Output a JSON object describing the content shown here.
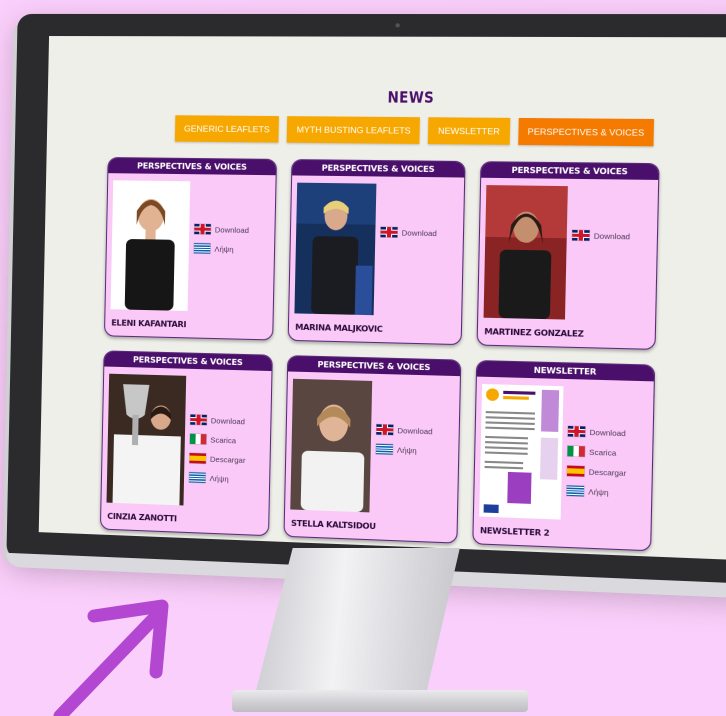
{
  "page": {
    "title": "NEWS"
  },
  "tabs": [
    {
      "label": "GENERIC LEAFLETS",
      "active": false
    },
    {
      "label": "MYTH BUSTING LEAFLETS",
      "active": false
    },
    {
      "label": "NEWSLETTER",
      "active": false
    },
    {
      "label": "PERSPECTIVES & VOICES",
      "active": true
    }
  ],
  "cards": [
    {
      "header": "PERSPECTIVES & VOICES",
      "name": "ELENI KAFANTARI",
      "links": [
        {
          "flag": "uk",
          "label": "Download"
        },
        {
          "flag": "gr",
          "label": "Λήψη"
        }
      ]
    },
    {
      "header": "PERSPECTIVES & VOICES",
      "name": "MARINA MALJKOVIC",
      "links": [
        {
          "flag": "uk",
          "label": "Download"
        }
      ]
    },
    {
      "header": "PERSPECTIVES & VOICES",
      "name": "MARTINEZ GONZALEZ",
      "links": [
        {
          "flag": "uk",
          "label": "Download"
        }
      ]
    },
    {
      "header": "PERSPECTIVES & VOICES",
      "name": "CINZIA ZANOTTI",
      "links": [
        {
          "flag": "uk",
          "label": "Download"
        },
        {
          "flag": "it",
          "label": "Scarica"
        },
        {
          "flag": "es",
          "label": "Descargar"
        },
        {
          "flag": "gr",
          "label": "Λήψη"
        }
      ]
    },
    {
      "header": "PERSPECTIVES & VOICES",
      "name": "STELLA KALTSIDOU",
      "links": [
        {
          "flag": "uk",
          "label": "Download"
        },
        {
          "flag": "gr",
          "label": "Λήψη"
        }
      ]
    },
    {
      "header": "NEWSLETTER",
      "name": "NEWSLETTER 2",
      "links": [
        {
          "flag": "uk",
          "label": "Download"
        },
        {
          "flag": "it",
          "label": "Scarica"
        },
        {
          "flag": "es",
          "label": "Descargar"
        },
        {
          "flag": "gr",
          "label": "Λήψη"
        }
      ]
    }
  ],
  "colors": {
    "background": "#fbcffb",
    "accent_purple": "#4a0f6a",
    "tab_orange": "#f7a800",
    "tab_active": "#f47a00",
    "card_bg": "#fbc9f8",
    "arrow": "#b347d1"
  }
}
